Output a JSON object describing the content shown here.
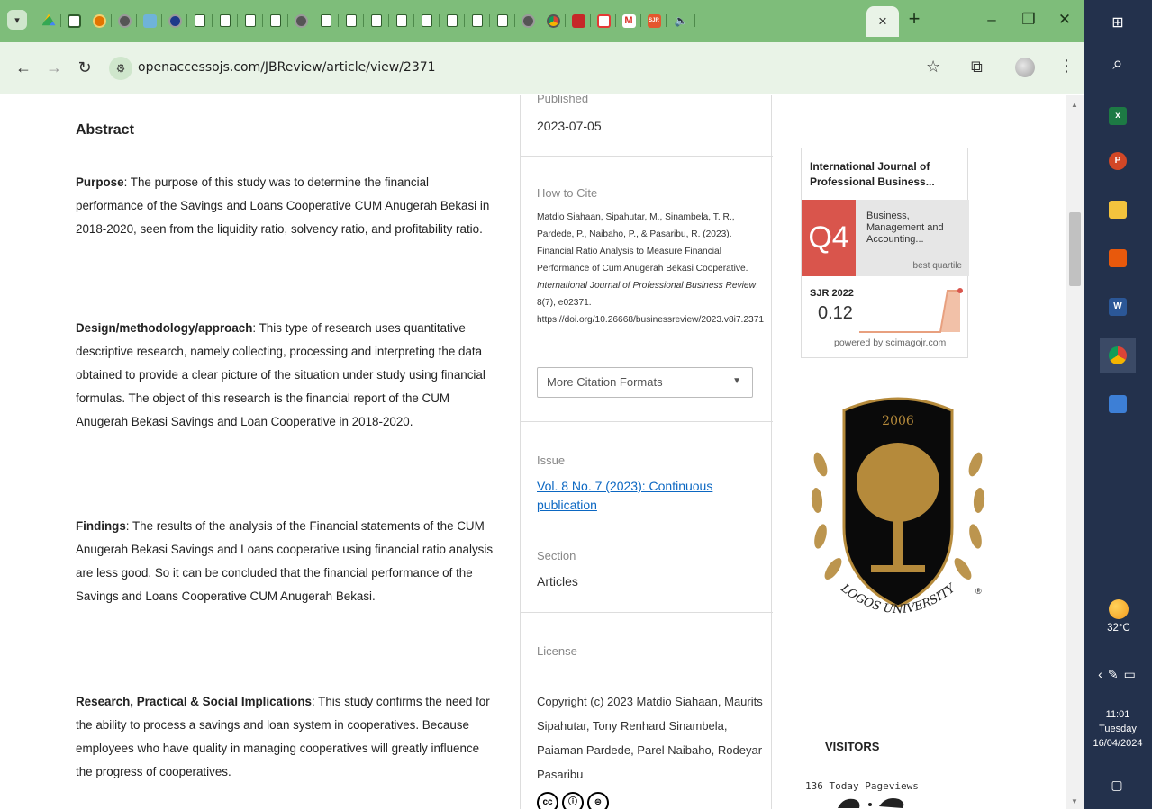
{
  "browser": {
    "url": "openaccessojs.com/JBReview/article/view/2371",
    "active_tab_icon": "speaker-icon",
    "close_symbol": "×",
    "new_tab_symbol": "+",
    "favicons": [
      "drive-icon",
      "doc-icon",
      "blogger-icon",
      "globe-icon",
      "user-icon",
      "globe-icon",
      "doc-icon",
      "doc-icon",
      "doc-icon",
      "doc-icon",
      "globe-icon",
      "doc-icon",
      "doc-icon",
      "doc-icon",
      "doc-icon",
      "doc-icon",
      "doc-icon",
      "doc-icon",
      "doc-icon",
      "globe-icon",
      "chrome-icon",
      "readinglist-icon",
      "acrobat-icon",
      "gmail-icon",
      "sjr-icon"
    ],
    "sjr_favicon_text": "SJR",
    "gmail_favicon_text": "M"
  },
  "abstract": {
    "heading": "Abstract",
    "purpose_label": "Purpose",
    "purpose_text": ": The purpose of this study was to determine the financial performance of the Savings and Loans Cooperative CUM Anugerah Bekasi in 2018-2020, seen from the liquidity ratio, solvency ratio, and profitability ratio.",
    "design_label": "Design/methodology/approach",
    "design_text": ": This type of research uses quantitative descriptive research, namely collecting, processing and interpreting the data obtained to provide a clear picture of the situation under study using financial formulas. The object of this research is the financial report of the CUM Anugerah Bekasi Savings and Loan Cooperative in 2018-2020.",
    "findings_label": "Findings",
    "findings_text": ": The results of the analysis of the Financial statements of the CUM Anugerah Bekasi Savings and Loans cooperative using financial ratio analysis are less good. So it can be concluded that the financial performance of the Savings and Loans Cooperative CUM Anugerah Bekasi.",
    "implications_label": "Research, Practical & Social Implications",
    "implications_text": ": This study confirms the need for the ability to process a savings and loan system in cooperatives. Because employees who have quality in managing cooperatives will greatly influence the progress of cooperatives."
  },
  "sidebar": {
    "published_label": "Published",
    "published_value": "2023-07-05",
    "cite_label": "How to Cite",
    "cite_authors": "Matdio Siahaan, Sipahutar, M., Sinambela, T. R., Pardede, P., Naibaho, P., & Pasaribu, R. (2023). Financial Ratio Analysis to Measure Financial Performance of Cum Anugerah Bekasi Cooperative. ",
    "cite_journal": "International Journal of Professional Business Review",
    "cite_volume": ", 8(7), e02371. https://doi.org/10.26668/businessreview/2023.v8i7.2371",
    "citation_formats": "More Citation Formats",
    "issue_label": "Issue",
    "issue_link": "Vol. 8 No. 7 (2023): Continuous publication",
    "section_label": "Section",
    "section_value": "Articles",
    "license_label": "License",
    "license_text": "Copyright (c) 2023 Matdio Siahaan, Maurits Sipahutar, Tony Renhard Sinambela, Paiaman Pardede, Parel Naibaho, Rodeyar Pasaribu",
    "cc_badges": [
      "cc",
      "ⓘ",
      "⊜"
    ]
  },
  "sjr": {
    "journal": "International Journal of Professional Business...",
    "quartile": "Q4",
    "category": "Business, Management and Accounting...",
    "best_quartile": "best quartile",
    "year_label": "SJR 2022",
    "value": "0.12",
    "powered": "powered by scimagojr.com",
    "colors": {
      "quartile": "#d9554c",
      "trend": "#e8a07f"
    }
  },
  "logo": {
    "year": "2006",
    "name": "LOGOS UNIVERSITY",
    "registered": "®"
  },
  "visitors": {
    "title": "VISITORS",
    "count_text": "136 Today Pageviews"
  },
  "taskbar": {
    "weather": "32°C",
    "time": "11:01",
    "day": "Tuesday",
    "date": "16/04/2024",
    "excel_letter": "x",
    "ppt_letter": "P",
    "word_letter": "W"
  }
}
